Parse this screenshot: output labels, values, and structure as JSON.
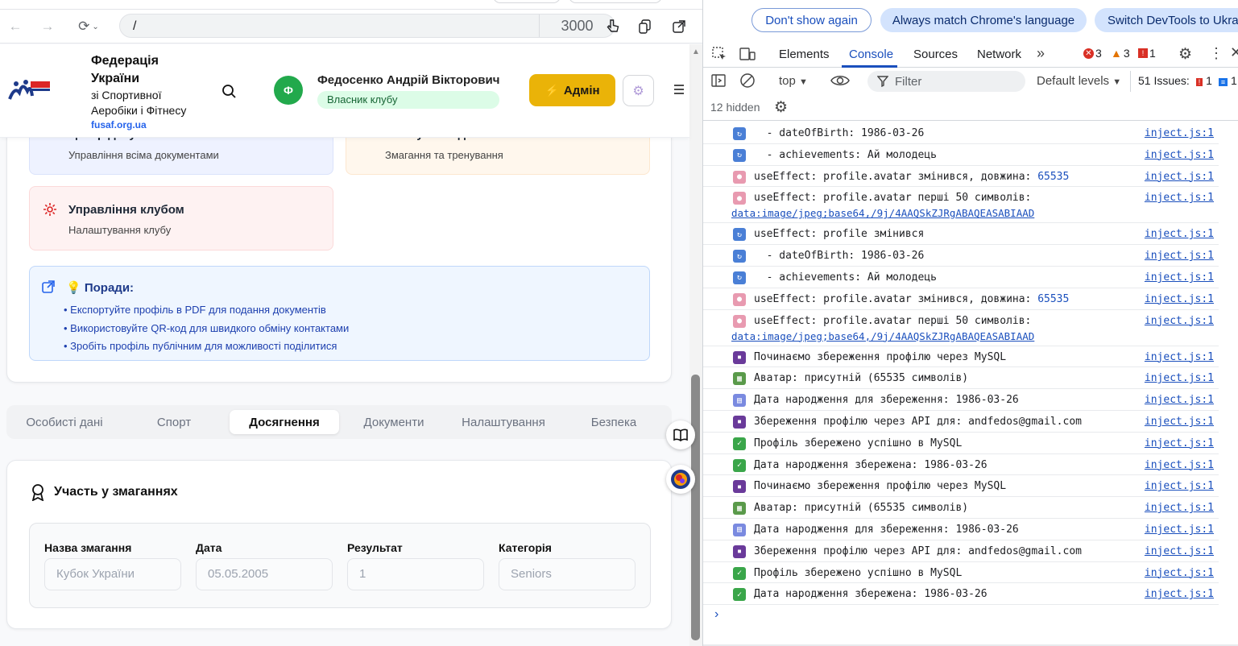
{
  "browser": {
    "url_path": "/",
    "port": "3000"
  },
  "header": {
    "org_line1": "Федерація",
    "org_line2": "України",
    "org_line3": "зі Спортивної",
    "org_line4": "Аеробіки і Фітнесу",
    "org_site": "fusaf.org.ua",
    "user_initial": "Ф",
    "user_name": "Федосенко Андрій Вікторович",
    "user_role": "Власник клубу",
    "admin_label": "Адмін",
    "admin_icon": "⚡"
  },
  "tiles": {
    "docs_title": "Центр документів",
    "docs_sub": "Управління всіма документами",
    "events_title": "Майбутні події",
    "events_sub": "Змагання та тренування",
    "club_title": "Управління клубом",
    "club_sub": "Налаштування клубу"
  },
  "tips": {
    "title": "💡 Поради:",
    "items": [
      "• Експортуйте профіль в PDF для подання документів",
      "• Використовуйте QR-код для швидкого обміну контактами",
      "• Зробіть профіль публічним для можливості поділитися"
    ]
  },
  "tabs": [
    "Особисті дані",
    "Спорт",
    "Досягнення",
    "Документи",
    "Налаштування",
    "Безпека"
  ],
  "active_tab": "Досягнення",
  "competitions": {
    "title": "Участь у змаганнях",
    "columns": [
      "Назва змагання",
      "Дата",
      "Результат",
      "Категорія"
    ],
    "row": [
      "Кубок України",
      "05.05.2005",
      "1",
      "Seniors"
    ]
  },
  "devtools": {
    "notice_buttons": [
      "Don't show again",
      "Always match Chrome's language",
      "Switch DevTools to Ukra"
    ],
    "tabs": [
      "Elements",
      "Console",
      "Sources",
      "Network"
    ],
    "active_tab": "Console",
    "errors": "3",
    "warnings": "3",
    "issues_count": "1",
    "context": "top",
    "filter_placeholder": "Filter",
    "levels": "Default levels",
    "issues_label": "51 Issues:",
    "issues_err": "1",
    "issues_info": "1",
    "hidden": "12 hidden",
    "messages": [
      {
        "icon": "refresh",
        "color": "#4a7fd6",
        "text": "  - dateOfBirth: 1986-03-26",
        "src": "inject.js:1"
      },
      {
        "icon": "refresh",
        "color": "#4a7fd6",
        "text": "  - achievements: Ай молодець",
        "src": "inject.js:1"
      },
      {
        "icon": "palette",
        "color": "#e89ab0",
        "text": "useEffect: profile.avatar змінився, довжина: ",
        "num": "65535",
        "src": "inject.js:1"
      },
      {
        "icon": "palette",
        "color": "#e89ab0",
        "text": "useEffect: profile.avatar перші 50 символів:",
        "text2": "data:image/jpeg;base64,/9j/4AAQSkZJRgABAQEASABIAAD",
        "src": "inject.js:1"
      },
      {
        "icon": "refresh",
        "color": "#4a7fd6",
        "text": "useEffect: profile змінився",
        "src": "inject.js:1"
      },
      {
        "icon": "refresh",
        "color": "#4a7fd6",
        "text": "  - dateOfBirth: 1986-03-26",
        "src": "inject.js:1"
      },
      {
        "icon": "refresh",
        "color": "#4a7fd6",
        "text": "  - achievements: Ай молодець",
        "src": "inject.js:1"
      },
      {
        "icon": "palette",
        "color": "#e89ab0",
        "text": "useEffect: profile.avatar змінився, довжина: ",
        "num": "65535",
        "src": "inject.js:1"
      },
      {
        "icon": "palette",
        "color": "#e89ab0",
        "text": "useEffect: profile.avatar перші 50 символів:",
        "text2": "data:image/jpeg;base64,/9j/4AAQSkZJRgABAQEASABIAAD",
        "src": "inject.js:1"
      },
      {
        "icon": "floppy",
        "color": "#6a3a9a",
        "text": "Починаємо збереження профілю через MySQL",
        "src": "inject.js:1"
      },
      {
        "icon": "picture",
        "color": "#5a9a4a",
        "text": "Аватар: присутній (65535 символів)",
        "src": "inject.js:1"
      },
      {
        "icon": "calendar",
        "color": "#7a8ae0",
        "text": "Дата народження для збереження: 1986-03-26",
        "src": "inject.js:1"
      },
      {
        "icon": "floppy",
        "color": "#6a3a9a",
        "text": "Збереження профілю через API для: andfedos@gmail.com",
        "src": "inject.js:1"
      },
      {
        "icon": "check",
        "color": "#3aa64a",
        "text": "Профіль збережено успішно в MySQL",
        "src": "inject.js:1"
      },
      {
        "icon": "check",
        "color": "#3aa64a",
        "text": "Дата народження збережена: 1986-03-26",
        "src": "inject.js:1"
      },
      {
        "icon": "floppy",
        "color": "#6a3a9a",
        "text": "Починаємо збереження профілю через MySQL",
        "src": "inject.js:1"
      },
      {
        "icon": "picture",
        "color": "#5a9a4a",
        "text": "Аватар: присутній (65535 символів)",
        "src": "inject.js:1"
      },
      {
        "icon": "calendar",
        "color": "#7a8ae0",
        "text": "Дата народження для збереження: 1986-03-26",
        "src": "inject.js:1"
      },
      {
        "icon": "floppy",
        "color": "#6a3a9a",
        "text": "Збереження профілю через API для: andfedos@gmail.com",
        "src": "inject.js:1"
      },
      {
        "icon": "check",
        "color": "#3aa64a",
        "text": "Профіль збережено успішно в MySQL",
        "src": "inject.js:1"
      },
      {
        "icon": "check",
        "color": "#3aa64a",
        "text": "Дата народження збережена: 1986-03-26",
        "src": "inject.js:1"
      }
    ]
  }
}
